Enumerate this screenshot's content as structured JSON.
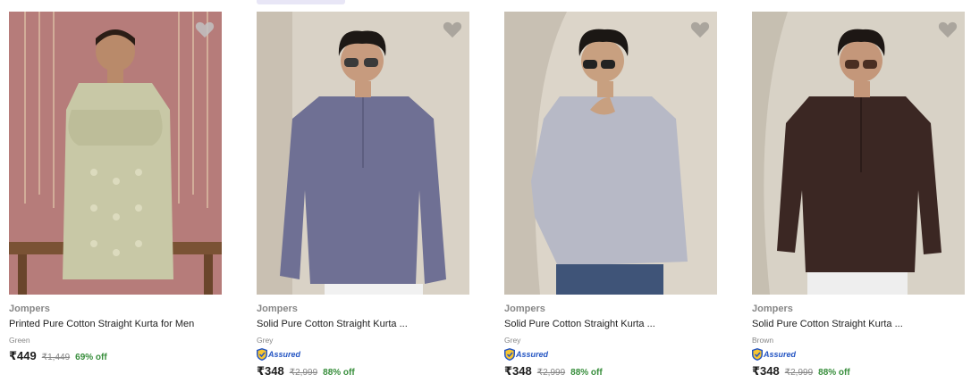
{
  "products": [
    {
      "brand": "Jompers",
      "title": "Printed Pure Cotton Straight Kurta for Men",
      "color": "Green",
      "assured": false,
      "price": "₹449",
      "mrp": "₹1,449",
      "discount": "69% off",
      "kurta_color": "#c8c8a6",
      "background": "#b67c7a"
    },
    {
      "brand": "Jompers",
      "title": "Solid Pure Cotton Straight Kurta ...",
      "color": "Grey",
      "assured": true,
      "assured_label": "Assured",
      "price": "₹348",
      "mrp": "₹2,999",
      "discount": "88% off",
      "kurta_color": "#6f7094",
      "background": "#d9d2c6"
    },
    {
      "brand": "Jompers",
      "title": "Solid Pure Cotton Straight Kurta ...",
      "color": "Grey",
      "assured": true,
      "assured_label": "Assured",
      "price": "₹348",
      "mrp": "₹2,999",
      "discount": "88% off",
      "kurta_color": "#b7b9c6",
      "background": "#dcd5c9"
    },
    {
      "brand": "Jompers",
      "title": "Solid Pure Cotton Straight Kurta ...",
      "color": "Brown",
      "assured": true,
      "assured_label": "Assured",
      "price": "₹348",
      "mrp": "₹2,999",
      "discount": "88% off",
      "kurta_color": "#3b2723",
      "background": "#d8d2c6"
    }
  ],
  "icons": {
    "wishlist": "heart-icon",
    "assured": "shield-check-icon"
  }
}
